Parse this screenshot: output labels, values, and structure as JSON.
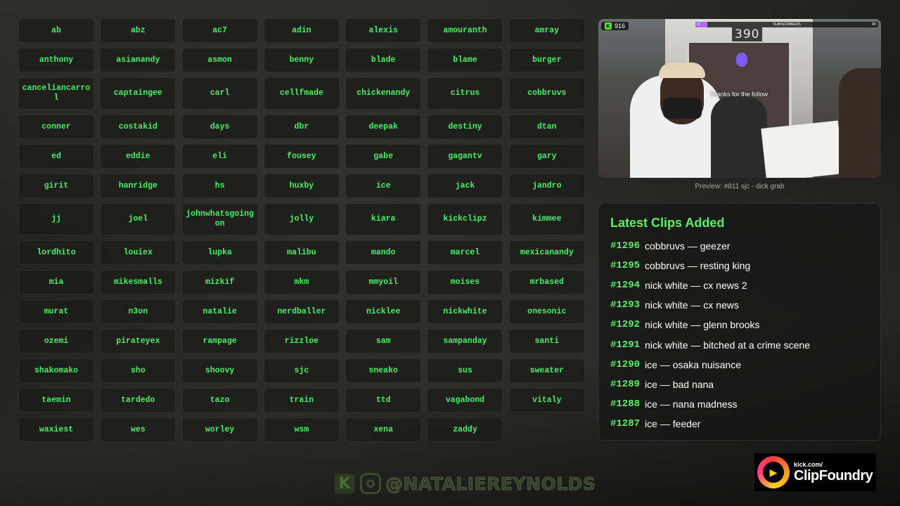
{
  "streamers": [
    [
      "ab",
      "abz",
      "ac7",
      "adin",
      "alexis",
      "amouranth",
      "amray"
    ],
    [
      "anthony",
      "asianandy",
      "asmon",
      "benny",
      "blade",
      "blame",
      "burger"
    ],
    [
      "canceliancarrol",
      "captaingee",
      "carl",
      "cellfmade",
      "chickenandy",
      "citrus",
      "cobbruvs"
    ],
    [
      "conner",
      "costakid",
      "days",
      "dbr",
      "deepak",
      "destiny",
      "dtan"
    ],
    [
      "ed",
      "eddie",
      "eli",
      "fousey",
      "gabe",
      "gagantv",
      "gary"
    ],
    [
      "girit",
      "hanridge",
      "hs",
      "huxby",
      "ice",
      "jack",
      "jandro"
    ],
    [
      "jj",
      "joel",
      "johnwhatsgoingon",
      "jolly",
      "kiara",
      "kickclipz",
      "kimmee"
    ],
    [
      "lordhito",
      "louiex",
      "lupka",
      "malibu",
      "mando",
      "marcel",
      "mexicanandy"
    ],
    [
      "mia",
      "mikesmalls",
      "mizkif",
      "mkm",
      "mmyoil",
      "moises",
      "mrbased"
    ],
    [
      "murat",
      "n3on",
      "natalie",
      "nerdballer",
      "nicklee",
      "nickwhite",
      "onesonic"
    ],
    [
      "ozemi",
      "pirateyex",
      "rampage",
      "rizzloe",
      "sam",
      "sampanday",
      "santi"
    ],
    [
      "shakomako",
      "sho",
      "shoovy",
      "sjc",
      "sneako",
      "sus",
      "sweater"
    ],
    [
      "taemin",
      "tardedo",
      "tazo",
      "train",
      "ttd",
      "vagabond",
      "vitaly"
    ],
    [
      "waxiest",
      "wes",
      "worley",
      "wsm",
      "xena",
      "zaddy"
    ]
  ],
  "preview": {
    "caption": "Preview: #811 sjc - dick grab",
    "viewer_count": "916",
    "subscribers_label": "SUBSCRIBERS",
    "subscribers_current": "6",
    "subscribers_goal": "90",
    "subscribers_progress": 0.067,
    "follow_text": "Thanks for the follow",
    "house_number": "390"
  },
  "latest_clips": {
    "title": "Latest Clips Added",
    "items": [
      {
        "id": "#1296",
        "text": "cobbruvs — geezer"
      },
      {
        "id": "#1295",
        "text": "cobbruvs — resting king"
      },
      {
        "id": "#1294",
        "text": "nick white — cx news 2"
      },
      {
        "id": "#1293",
        "text": "nick white — cx news"
      },
      {
        "id": "#1292",
        "text": "nick white — glenn brooks"
      },
      {
        "id": "#1291",
        "text": "nick white — bitched at a crime scene"
      },
      {
        "id": "#1290",
        "text": "ice — osaka nuisance"
      },
      {
        "id": "#1289",
        "text": "ice — bad nana"
      },
      {
        "id": "#1288",
        "text": "ice — nana madness"
      },
      {
        "id": "#1287",
        "text": "ice — feeder"
      }
    ]
  },
  "social": {
    "kick_icon": "kick-logo-icon",
    "instagram_icon": "instagram-icon",
    "handle": "@NATALIEREYNOLDS"
  },
  "brand": {
    "small": "kick.com/",
    "big": "ClipFoundry"
  },
  "colors": {
    "accent_green": "#4cf064",
    "kick_green": "#53fc18"
  }
}
